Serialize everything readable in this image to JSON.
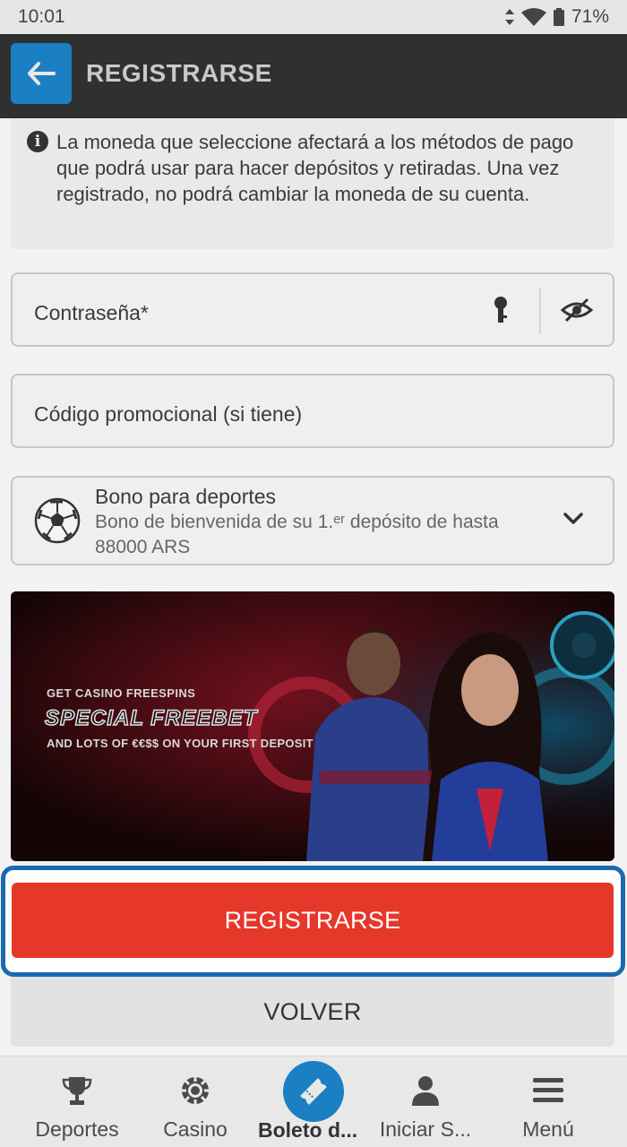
{
  "status_bar": {
    "time": "10:01",
    "battery": "71%"
  },
  "header": {
    "title": "REGISTRARSE",
    "back_icon": "arrow-left-icon"
  },
  "info": {
    "text": "La moneda que seleccione afectará a los métodos de pago que podrá usar para hacer depósitos y retiradas. Una vez registrado, no podrá cambiar la moneda de su cuenta."
  },
  "fields": {
    "password_label": "Contraseña*",
    "promo_label": "Código promocional (si tiene)"
  },
  "bonus": {
    "title": "Bono para deportes",
    "description": "Bono de bienvenida de su 1.ᵉʳ depósito de hasta 88000 ARS"
  },
  "banner": {
    "top_text": "GET CASINO FREESPINS",
    "main_text": "SPECIAL FREEBET",
    "sub_text": "AND LOTS OF €€$$ ON YOUR FIRST DEPOSIT"
  },
  "buttons": {
    "register": "REGISTRARSE",
    "back": "VOLVER"
  },
  "bottom_nav": {
    "items": [
      {
        "label": "Deportes",
        "icon": "trophy-icon"
      },
      {
        "label": "Casino",
        "icon": "poker-chip-icon"
      },
      {
        "label": "Boleto d...",
        "icon": "ticket-icon"
      },
      {
        "label": "Iniciar S...",
        "icon": "user-icon"
      },
      {
        "label": "Menú",
        "icon": "menu-icon"
      }
    ]
  },
  "colors": {
    "accent_blue": "#1b7fc4",
    "register_red": "#e5372a",
    "header_dark": "#303030"
  }
}
